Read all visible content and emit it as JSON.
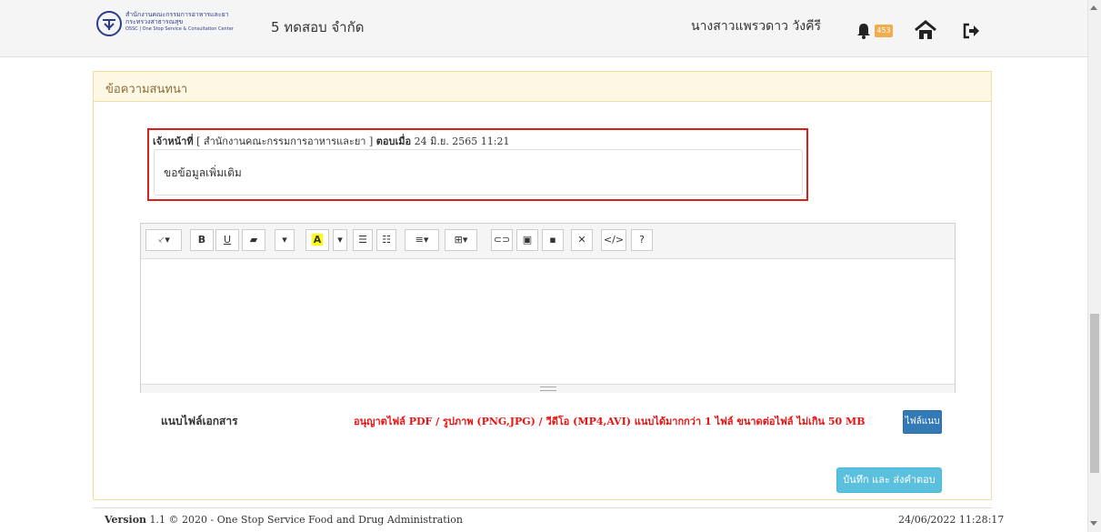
{
  "header": {
    "logo_line1": "สำนักงานคณะกรรมการอาหารและยา",
    "logo_line2": "กระทรวงสาธารณสุข",
    "logo_line3": "OSSC | One Stop Service & Consultation Center",
    "company": "5 ทดสอบ จำกัด",
    "username": "นางสาวแพรวดาว วังคีรี",
    "notification_count": "453",
    "icons": [
      "bell-icon",
      "home-icon",
      "logout-icon"
    ]
  },
  "panel": {
    "title": "ข้อความสนทนา"
  },
  "message": {
    "role": "เจ้าหน้าที่",
    "agency": "[ สำนักงานคณะกรรมการอาหารและยา ]",
    "replied_label": "ตอบเมื่อ",
    "replied_time": "24 มิ.ย. 2565 11:21",
    "body": "ขอข้อมูลเพิ่มเติม"
  },
  "editor": {
    "toolbar": [
      {
        "name": "style-button",
        "label": "⸔▾"
      },
      {
        "name": "bold-button",
        "label": "B"
      },
      {
        "name": "underline-button",
        "label": "U"
      },
      {
        "name": "clear-format-button",
        "label": "▰"
      },
      {
        "name": "font-dropdown-button",
        "label": "▾"
      },
      {
        "name": "highlight-color-button",
        "label": "A"
      },
      {
        "name": "color-dropdown-button",
        "label": "▾"
      },
      {
        "name": "unordered-list-button",
        "label": "☰"
      },
      {
        "name": "ordered-list-button",
        "label": "☷"
      },
      {
        "name": "paragraph-button",
        "label": "≡▾"
      },
      {
        "name": "table-button",
        "label": "⊞▾"
      },
      {
        "name": "link-button",
        "label": "⊂⊃"
      },
      {
        "name": "picture-button",
        "label": "▣"
      },
      {
        "name": "video-button",
        "label": "▪"
      },
      {
        "name": "fullscreen-button",
        "label": "✕"
      },
      {
        "name": "code-view-button",
        "label": "</>"
      },
      {
        "name": "help-button",
        "label": "?"
      }
    ]
  },
  "attach": {
    "label": "แนบไฟล์เอกสาร",
    "rule": "อนุญาตไฟล์ PDF / รูปภาพ (PNG,JPG) / วีดีโอ (MP4,AVI) แนบได้มากกว่า 1 ไฟล์ ขนาดต่อไฟล์ ไม่เกิน 50 MB",
    "button": "ไฟล์แนบ"
  },
  "submit": {
    "label": "บันทึก และ ส่งคำตอบ"
  },
  "footer": {
    "version_label": "Version",
    "version_text": "1.1 © 2020 - One Stop Service Food and Drug Administration",
    "timestamp": "24/06/2022 11:28:17"
  },
  "colors": {
    "primary": "#337ab7",
    "info": "#5bc0de",
    "warning": "#f0ad4e",
    "danger": "#ee1111",
    "panel_head": "#fcf8e3"
  }
}
